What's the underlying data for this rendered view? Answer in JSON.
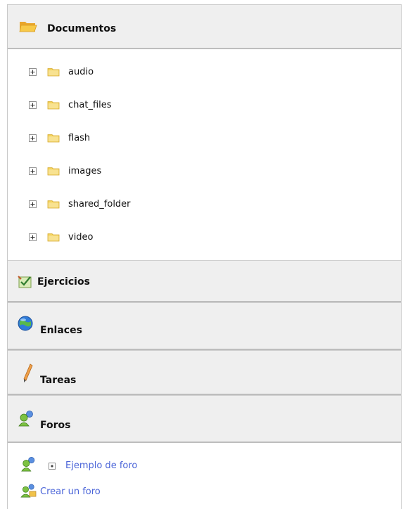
{
  "sections": {
    "documentos": {
      "title": "Documentos",
      "icon": "folder-open-icon"
    },
    "ejercicios": {
      "title": "Ejercicios",
      "icon": "exercises-icon"
    },
    "enlaces": {
      "title": "Enlaces",
      "icon": "globe-icon"
    },
    "tareas": {
      "title": "Tareas",
      "icon": "pencil-icon"
    },
    "foros": {
      "title": "Foros",
      "icon": "users-icon"
    }
  },
  "folders": [
    "audio",
    "chat_files",
    "flash",
    "images",
    "shared_folder",
    "video"
  ],
  "foros": {
    "forum_link": "Ejemplo de foro",
    "create_link": "Crear un foro"
  },
  "colors": {
    "header_bg": "#efefef",
    "link": "#4a64d8",
    "folder": "#f3d25a"
  }
}
